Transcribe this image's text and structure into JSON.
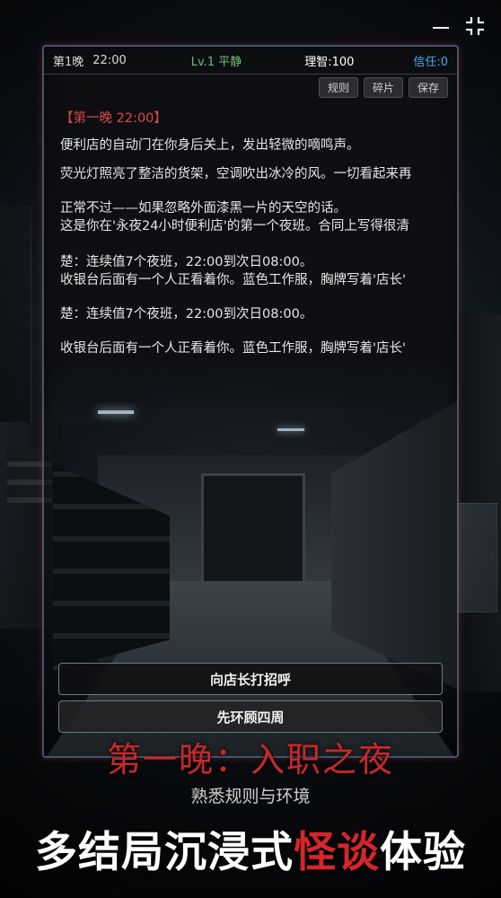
{
  "window": {
    "minimize_icon": "minimize-icon",
    "fullscreen_icon": "fullscreen-icon"
  },
  "status": {
    "night": "第1晚",
    "time": "22:00",
    "level": "Lv.1 平静",
    "sanity": "理智:100",
    "trust": "信任:0"
  },
  "toolbar": {
    "rules": "规则",
    "fragments": "碎片",
    "save": "保存"
  },
  "story": {
    "heading": "【第一晚 22:00】",
    "lines": [
      "便利店的自动门在你身后关上，发出轻微的嘀鸣声。",
      "荧光灯照亮了整洁的货架，空调吹出冰冷的风。一切看起来再",
      "正常不过——如果忽略外面漆黑一片的天空的话。",
      "这是你在'永夜24小时便利店'的第一个夜班。合同上写得很清",
      "楚：连续值7个夜班，22:00到次日08:00。",
      "收银台后面有一个人正看着你。蓝色工作服，胸牌写着'店长'",
      "楚：连续值7个夜班，22:00到次日08:00。",
      "收银台后面有一个人正看着你。蓝色工作服，胸牌写着'店长'"
    ]
  },
  "choices": {
    "greet": "向店长打招呼",
    "look_around": "先环顾四周"
  },
  "promo": {
    "title": "第一晚：入职之夜",
    "subtitle": "熟悉规则与环境",
    "tagline_a": "多结局沉浸式",
    "tagline_red": "怪谈",
    "tagline_b": "体验"
  },
  "colors": {
    "accent_red": "#c8282a",
    "level_green": "#6fbf6f",
    "trust_blue": "#4fa7e8"
  }
}
